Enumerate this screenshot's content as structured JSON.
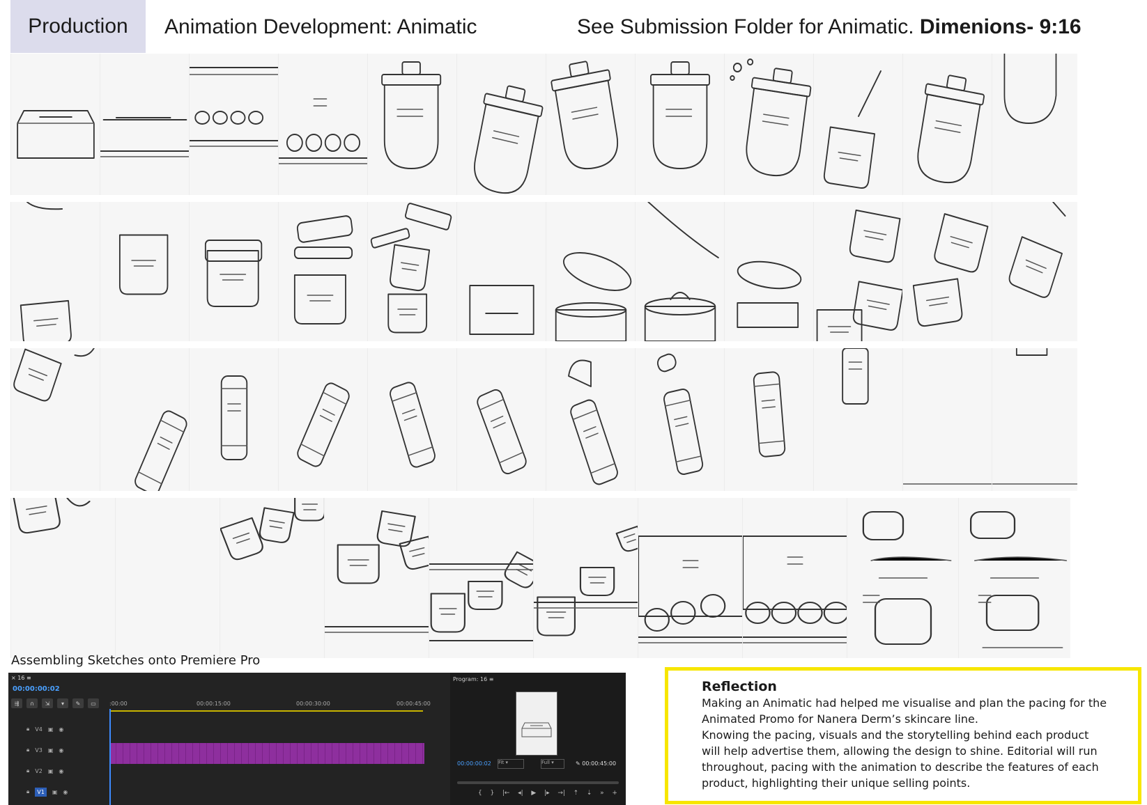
{
  "header": {
    "section_tag": "Production",
    "title": "Animation Development: Animatic",
    "note_plain": "See Submission Folder for Animatic.",
    "note_bold": "Dimenions- 9:16"
  },
  "storyboard": {
    "row1": [
      "box-closed",
      "box-lid-slit",
      "box-open-jars",
      "box-jars-row",
      "jar-pump-bottle",
      "pump-bottle-tilted",
      "pump-bottle-tilt-left",
      "pump-bottle-upright",
      "pump-bottle-bubbles",
      "pump-bottle-open",
      "pump-bottle-closing",
      "pump-bottle-exit"
    ],
    "row2": [
      "jar-bottom-corner",
      "cream-jar-front",
      "cream-jar-lid",
      "jar-lid-lifting",
      "jar-lid-open",
      "jar-box-bottom",
      "jar-lid-large",
      "jar-cream-scoop",
      "jar-lid-floating",
      "jars-cluster",
      "jar-tilted",
      "jar-edge"
    ],
    "row3": [
      "bottle-corner",
      "bottle-bottom-right",
      "tube-upright",
      "tube-tilted-right",
      "tube-tilted-left",
      "tube-diagonal",
      "tube-cap-off",
      "serum-bottle",
      "serum-bottle-upright",
      "serum-bottle-exit",
      "blank-frame",
      "frame-end"
    ],
    "row4": [
      "jar-pieces-top",
      "blank-panel",
      "jars-falling",
      "jars-scatter",
      "jars-landing",
      "jars-box-base",
      "box-filling",
      "box-full",
      "logo-card",
      "logo-card-final"
    ]
  },
  "premiere": {
    "caption": "Assembling Sketches onto Premiere Pro",
    "sequence_tab": "16",
    "current_time": "00:00:00:02",
    "ruler_ticks": [
      ":00:00",
      "00:00:15:00",
      "00:00:30:00",
      "00:00:45:00"
    ],
    "tracks": [
      "V4",
      "V3",
      "V2",
      "V1"
    ],
    "program_tab": "Program: 16",
    "program_time": "00:00:00:02",
    "fit_option": "Fit",
    "quality_option": "Full",
    "duration": "00:00:45:00"
  },
  "reflection": {
    "heading": "Reflection",
    "lines": [
      "Making an Animatic had helped me visualise and plan the pacing for the",
      "Animated Promo for Nanera Derm’s skincare line.",
      "Knowing the pacing, visuals and the storytelling behind each product",
      "will help advertise them, allowing the design to shine. Editorial will run",
      "throughout, pacing with the animation to describe the features of each",
      "product, highlighting their unique selling points."
    ]
  },
  "colors": {
    "tag_bg": "#dcdcec",
    "reflection_border": "#f7e600",
    "clip": "#8e2f9e",
    "timecode": "#4aa0ff"
  }
}
